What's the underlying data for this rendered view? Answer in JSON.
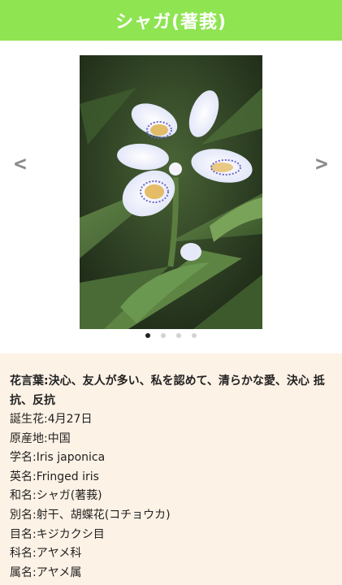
{
  "header": {
    "title": "シャガ(著莪)"
  },
  "gallery": {
    "prev_label": "<",
    "next_label": ">",
    "image_subject": "iris-flower-photo",
    "dot_count": 4,
    "active_index": 0
  },
  "info": {
    "flower_language": "花言葉:決心、友人が多い、私を認めて、清らかな愛、決心 抵抗、反抗",
    "birth_flower": "誕生花:4月27日",
    "origin": "原産地:中国",
    "scientific_name": "学名:Iris japonica",
    "english_name": "英名:Fringed iris",
    "japanese_name": "和名:シャガ(著莪)",
    "other_names": "別名:射干、胡蝶花(コチョウカ)",
    "order": "目名:キジカクシ目",
    "family": "科名:アヤメ科",
    "genus": "属名:アヤメ属"
  },
  "colors": {
    "header_bg": "#8ee451",
    "info_bg": "#fdf2e6",
    "arrow": "#8a8a8a"
  }
}
